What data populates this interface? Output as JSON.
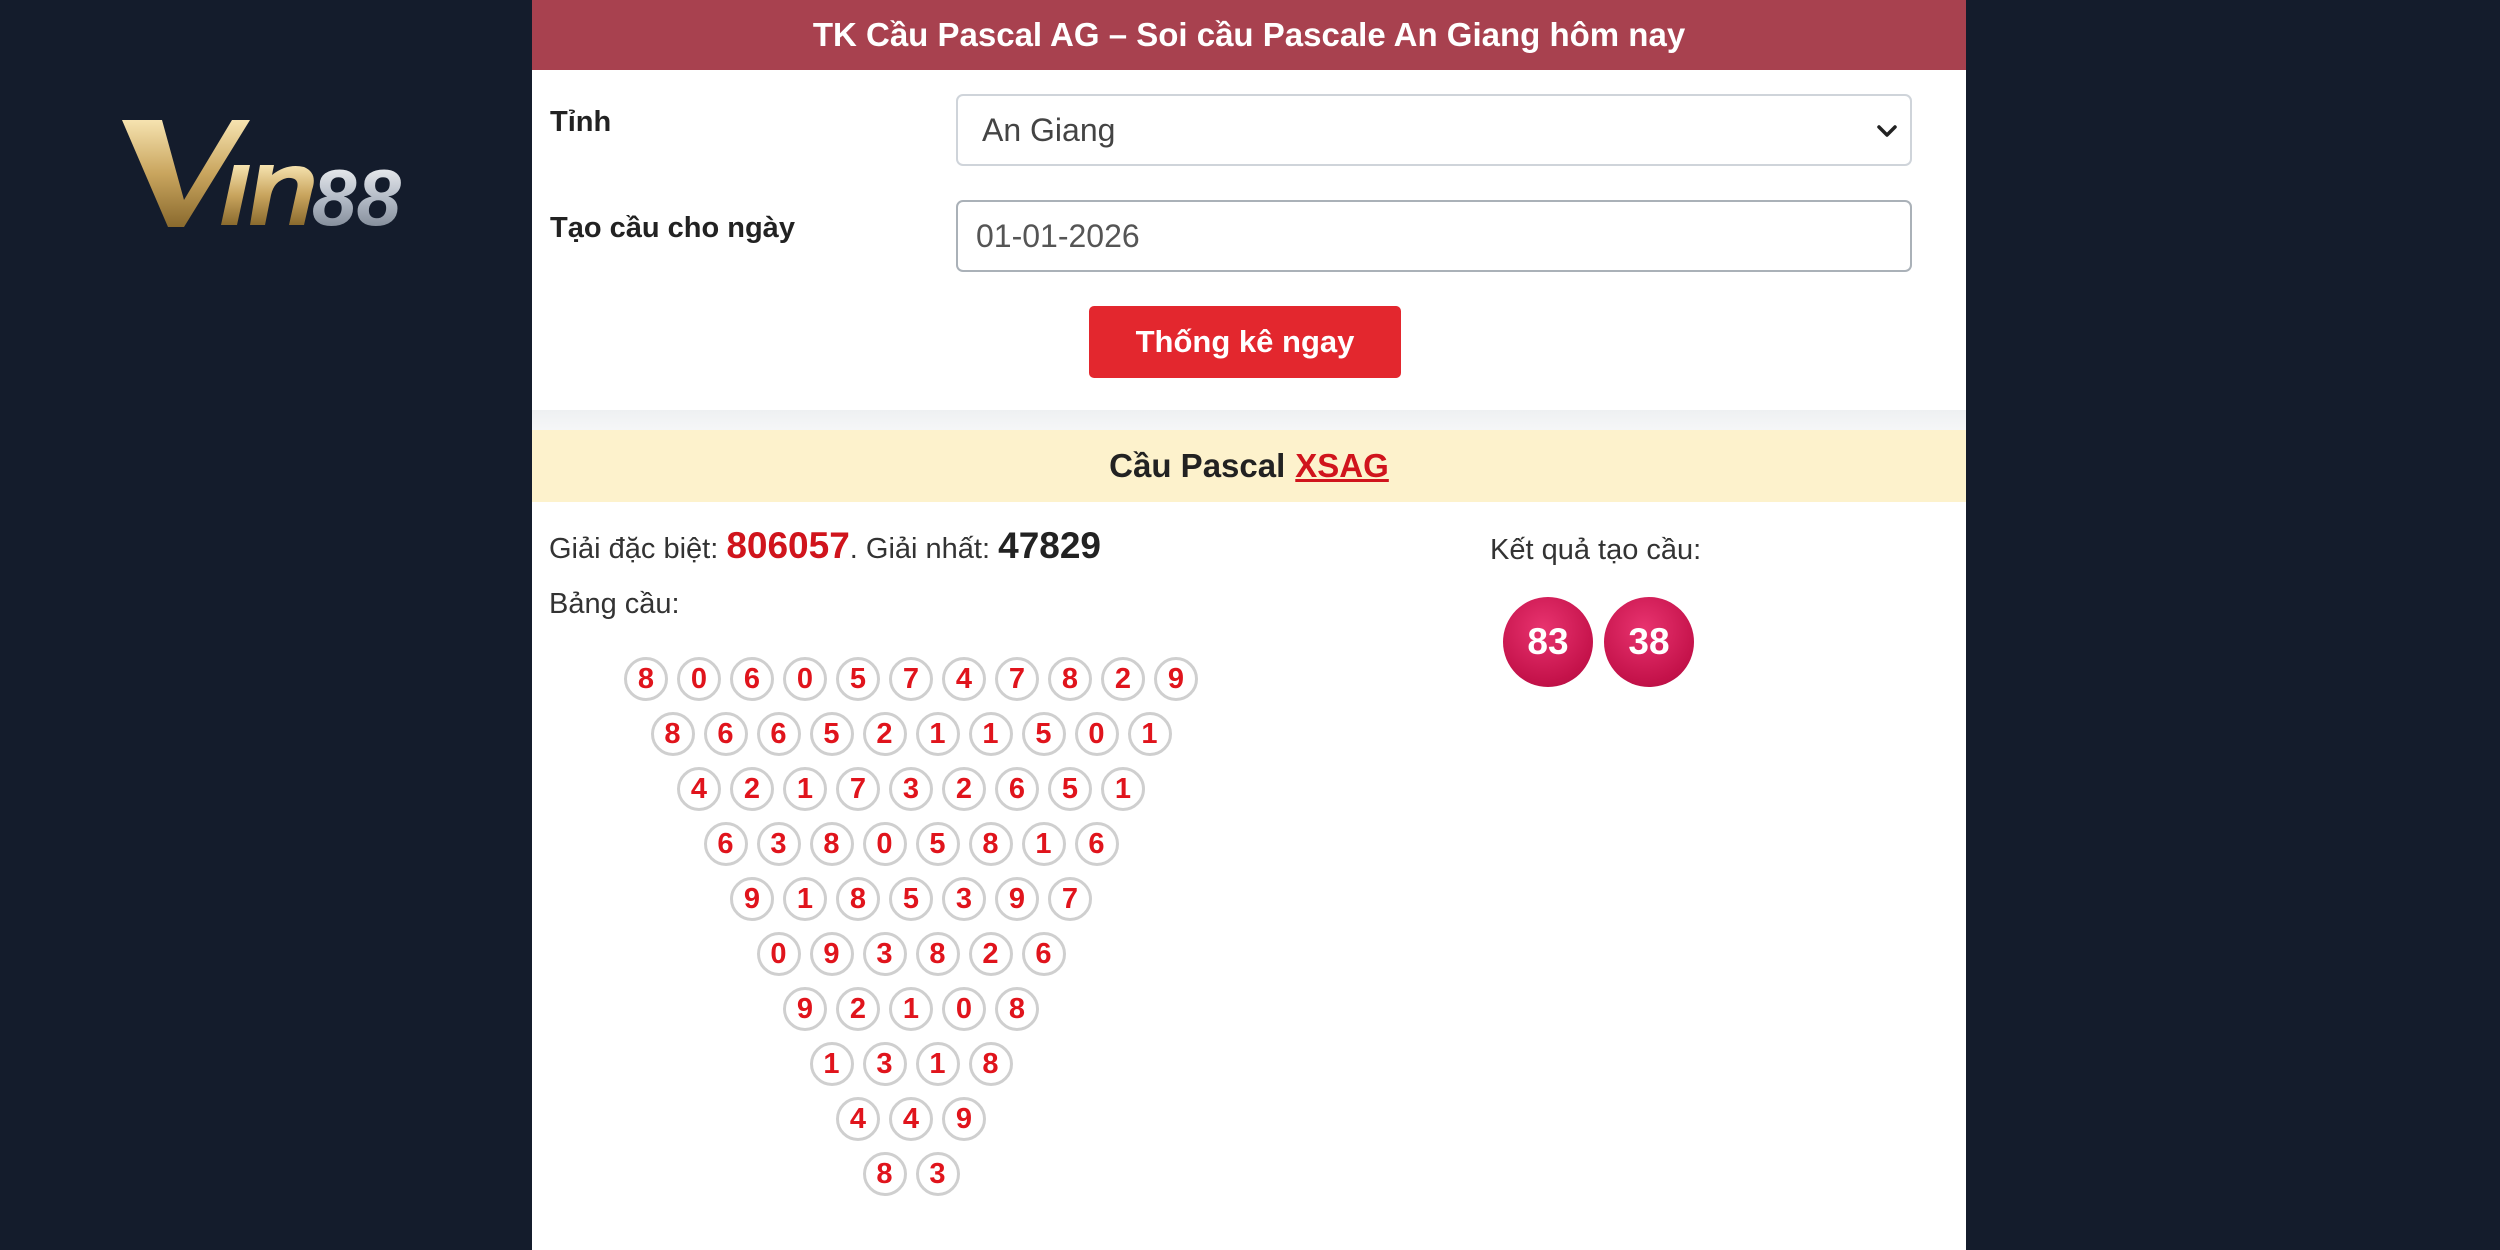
{
  "logo": {
    "text": "Vin88",
    "icon": "vin88-logo"
  },
  "header": {
    "title": "TK Cầu Pascal AG – Soi cầu Pascale An Giang hôm nay"
  },
  "form": {
    "province_label": "Tỉnh",
    "province_value": "An Giang",
    "date_label": "Tạo cầu cho ngày",
    "date_value": "01-01-2026",
    "submit_label": "Thống kê ngay"
  },
  "section": {
    "title_prefix": "Cầu Pascal",
    "title_link": "XSAG"
  },
  "prizes": {
    "special_label": "Giải đặc biệt:",
    "special_value": "806057",
    "separator": ".",
    "first_label": "Giải nhất:",
    "first_value": "47829"
  },
  "table_label": "Bảng cầu:",
  "result_label": "Kết quả tạo cầu:",
  "results": [
    "83",
    "38"
  ],
  "pascal_rows": [
    [
      "8",
      "0",
      "6",
      "0",
      "5",
      "7",
      "4",
      "7",
      "8",
      "2",
      "9"
    ],
    [
      "8",
      "6",
      "6",
      "5",
      "2",
      "1",
      "1",
      "5",
      "0",
      "1"
    ],
    [
      "4",
      "2",
      "1",
      "7",
      "3",
      "2",
      "6",
      "5",
      "1"
    ],
    [
      "6",
      "3",
      "8",
      "0",
      "5",
      "8",
      "1",
      "6"
    ],
    [
      "9",
      "1",
      "8",
      "5",
      "3",
      "9",
      "7"
    ],
    [
      "0",
      "9",
      "3",
      "8",
      "2",
      "6"
    ],
    [
      "9",
      "2",
      "1",
      "0",
      "8"
    ],
    [
      "1",
      "3",
      "1",
      "8"
    ],
    [
      "4",
      "4",
      "9"
    ],
    [
      "8",
      "3"
    ]
  ],
  "colors": {
    "header_bg": "#a8414f",
    "button_bg": "#e3272e",
    "accent_red": "#d0141c",
    "ball": "#c4124a",
    "section_bg": "#fdf2cc"
  }
}
